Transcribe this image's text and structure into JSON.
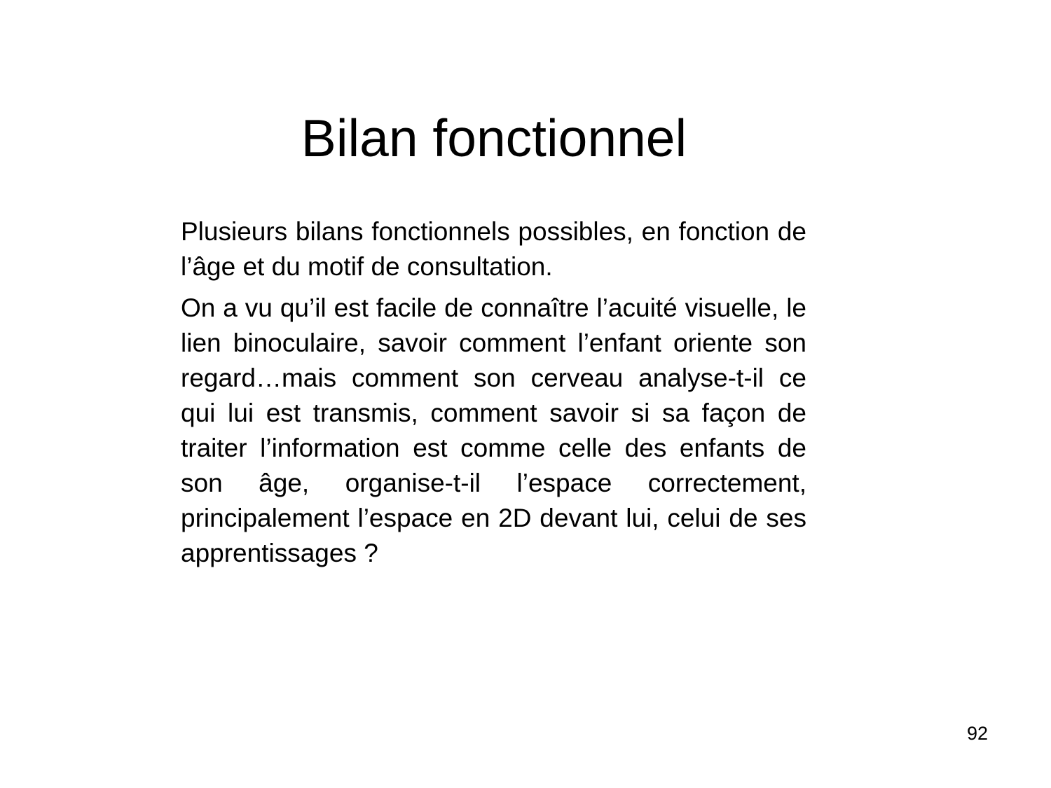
{
  "slide": {
    "title": "Bilan fonctionnel",
    "paragraphs": [
      "Plusieurs bilans fonctionnels possibles, en fonction de l’âge et du motif de consultation.",
      "On a vu qu’il est facile de connaître l’acuité visuelle, le lien binoculaire, savoir comment l’enfant oriente son regard…mais comment son cerveau analyse-t-il ce qui lui est transmis, comment savoir si sa façon de traiter l’information est comme celle des enfants de son âge, organise-t-il l’espace correctement, principalement l’espace en 2D devant lui, celui de ses apprentissages ?"
    ],
    "page_number": "92"
  }
}
